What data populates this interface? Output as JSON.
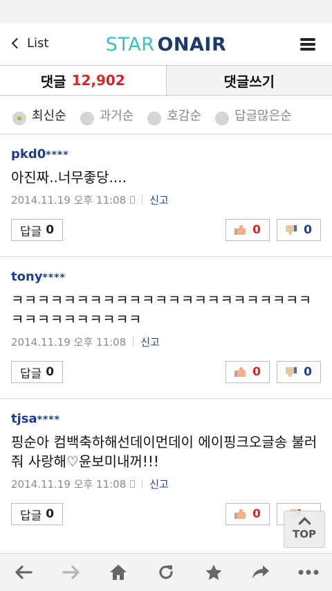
{
  "header": {
    "back_label": "List",
    "logo_star": "STAR",
    "logo_onair": "ONAIR"
  },
  "tabs": {
    "comments_label": "댓글",
    "comments_count": "12,902",
    "write_label": "댓글쓰기"
  },
  "sort": {
    "options": [
      "최신순",
      "과거순",
      "호감순",
      "답글많은순"
    ],
    "selected": "최신순"
  },
  "comments": [
    {
      "author": "pkd0",
      "mask": "****",
      "text": "아진짜..너무좋당....",
      "timestamp": "2014.11.19 오후 11:08",
      "mobile": true,
      "report_label": "신고",
      "reply_label": "답글",
      "reply_count": "0",
      "likes": "0",
      "dislikes": "0"
    },
    {
      "author": "tony",
      "mask": "****",
      "text": "ㅋㅋㅋㅋㅋㅋㅋㅋㅋㅋㅋㅋㅋㅋㅋㅋㅋㅋㅋㅋㅋㅋㅋㅋㅋㅋㅋㅋㅋㅋㅋㅋㅋ",
      "timestamp": "2014.11.19 오후 11:08",
      "mobile": false,
      "report_label": "신고",
      "reply_label": "답글",
      "reply_count": "0",
      "likes": "0",
      "dislikes": "0"
    },
    {
      "author": "tjsa",
      "mask": "****",
      "text": "핑순아 컴백축하해선데이먼데이 에이핑크오글송 불러줘 사랑해♡윤보미내꺼!!!",
      "timestamp": "2014.11.19 오후 11:08",
      "mobile": true,
      "report_label": "신고",
      "reply_label": "답글",
      "reply_count": "0",
      "likes": "0",
      "dislikes": ""
    }
  ],
  "top_button": {
    "label": "TOP"
  },
  "browser_nav": {
    "icons": [
      "back-arrow-icon",
      "forward-arrow-icon",
      "home-icon",
      "refresh-icon",
      "star-icon",
      "share-icon",
      "more-icon"
    ]
  },
  "colors": {
    "accent_red": "#d7262b",
    "author_blue": "#1e3d8a",
    "logo_teal": "#36c0c2",
    "logo_navy": "#1e3a6b",
    "radio_green": "#8cc63e"
  }
}
